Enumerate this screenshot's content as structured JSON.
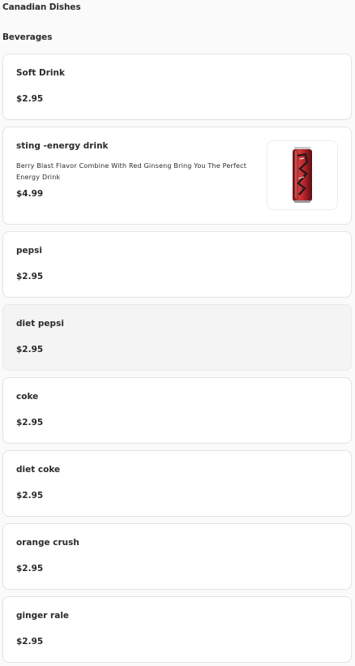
{
  "header": {
    "category_title": "Canadian Dishes",
    "section_title": "Beverages"
  },
  "items": [
    {
      "name": "Soft Drink",
      "price": "$2.95"
    },
    {
      "name": "sting -energy drink",
      "description": "Berry Blast Flavor Combine With Red Ginseng Bring You The Perfect Energy Drink",
      "price": "$4.99",
      "image_icon": "energy-drink-can-icon"
    },
    {
      "name": "pepsi",
      "price": "$2.95"
    },
    {
      "name": "diet pepsi",
      "price": "$2.95"
    },
    {
      "name": "coke",
      "price": "$2.95"
    },
    {
      "name": "diet coke",
      "price": "$2.95"
    },
    {
      "name": "orange crush",
      "price": "$2.95"
    },
    {
      "name": "ginger rale",
      "price": "$2.95"
    }
  ],
  "colors": {
    "background": "#fafafa",
    "card_background": "#ffffff",
    "card_border": "#e3e3e3",
    "highlight_background": "#f4f4f4",
    "text": "#2b2b2b",
    "can_red": "#c0262b"
  }
}
